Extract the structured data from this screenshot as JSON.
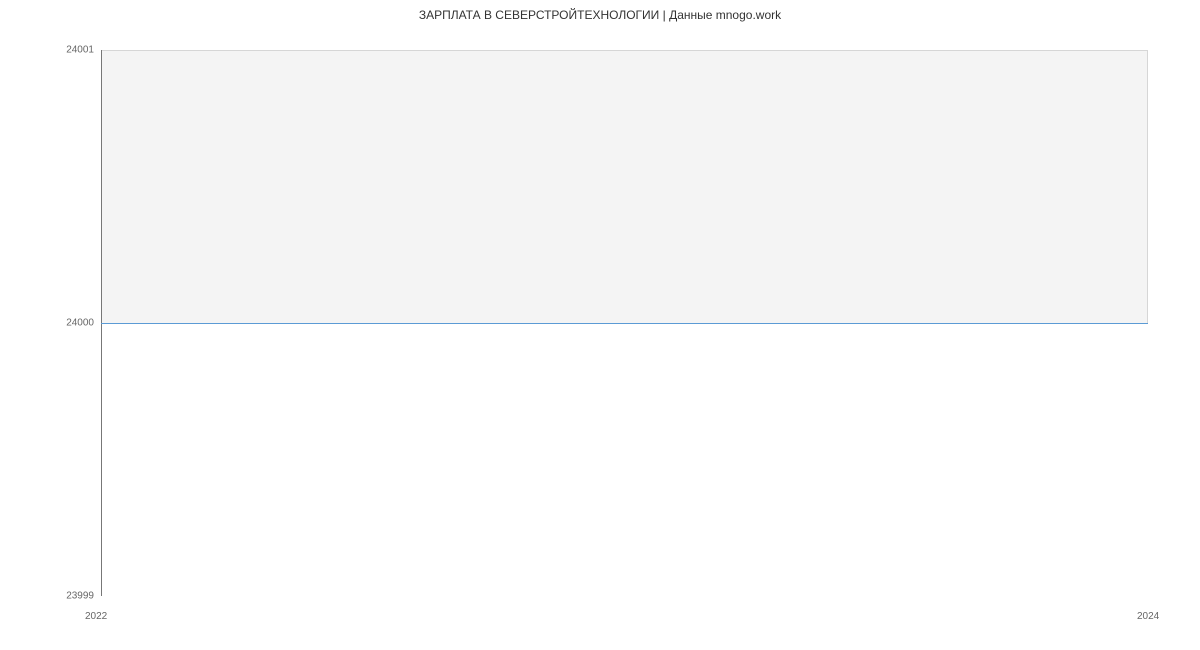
{
  "chart_data": {
    "type": "line",
    "title": "ЗАРПЛАТА В  СЕВЕРСТРОЙТЕХНОЛОГИИ | Данные mnogo.work",
    "x": [
      2022,
      2024
    ],
    "values": [
      24000,
      24000
    ],
    "xlabel": "",
    "ylabel": "",
    "xlim": [
      2022,
      2024
    ],
    "ylim": [
      23999,
      24001
    ],
    "x_ticks": [
      "2022",
      "2024"
    ],
    "y_ticks": [
      "23999",
      "24000",
      "24001"
    ]
  }
}
